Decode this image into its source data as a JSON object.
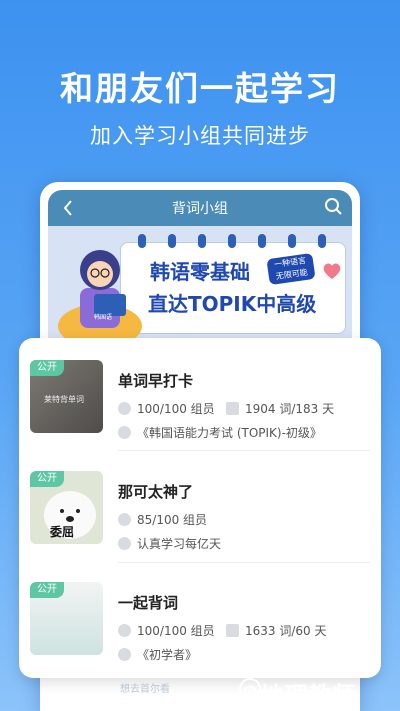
{
  "promo": {
    "headline": "和朋友们一起学习",
    "subline": "加入学习小组共同进步"
  },
  "topbar": {
    "title": "背词小组"
  },
  "banner": {
    "line1": "韩语零基础",
    "line2": "直达TOPIK中高级",
    "tag_line1": "一种语言",
    "tag_line2": "无限可能",
    "book_label": "韩国语"
  },
  "groups": [
    {
      "badge": "公开",
      "title": "单词早打卡",
      "members": "100/100 组员",
      "words": "1904 词/183 天",
      "book": "《韩国语能力考试 (TOPIK)-初级》",
      "thumb_text": "莱特背单词"
    },
    {
      "badge": "公开",
      "title": "那可太神了",
      "members": "85/100 组员",
      "motto": "认真学习每亿天",
      "thumb_text": "委屈"
    },
    {
      "badge": "公开",
      "title": "一起背词",
      "members": "100/100 组员",
      "words": "1633 词/60 天",
      "book": "《初学者》"
    }
  ],
  "peek_text": "想去首尔看",
  "watermark": "地理教师",
  "colors": {
    "background": "#3d92f0",
    "topbar": "#4a8bb8",
    "badge": "#5cc7a2",
    "banner_text": "#1f49b0"
  }
}
